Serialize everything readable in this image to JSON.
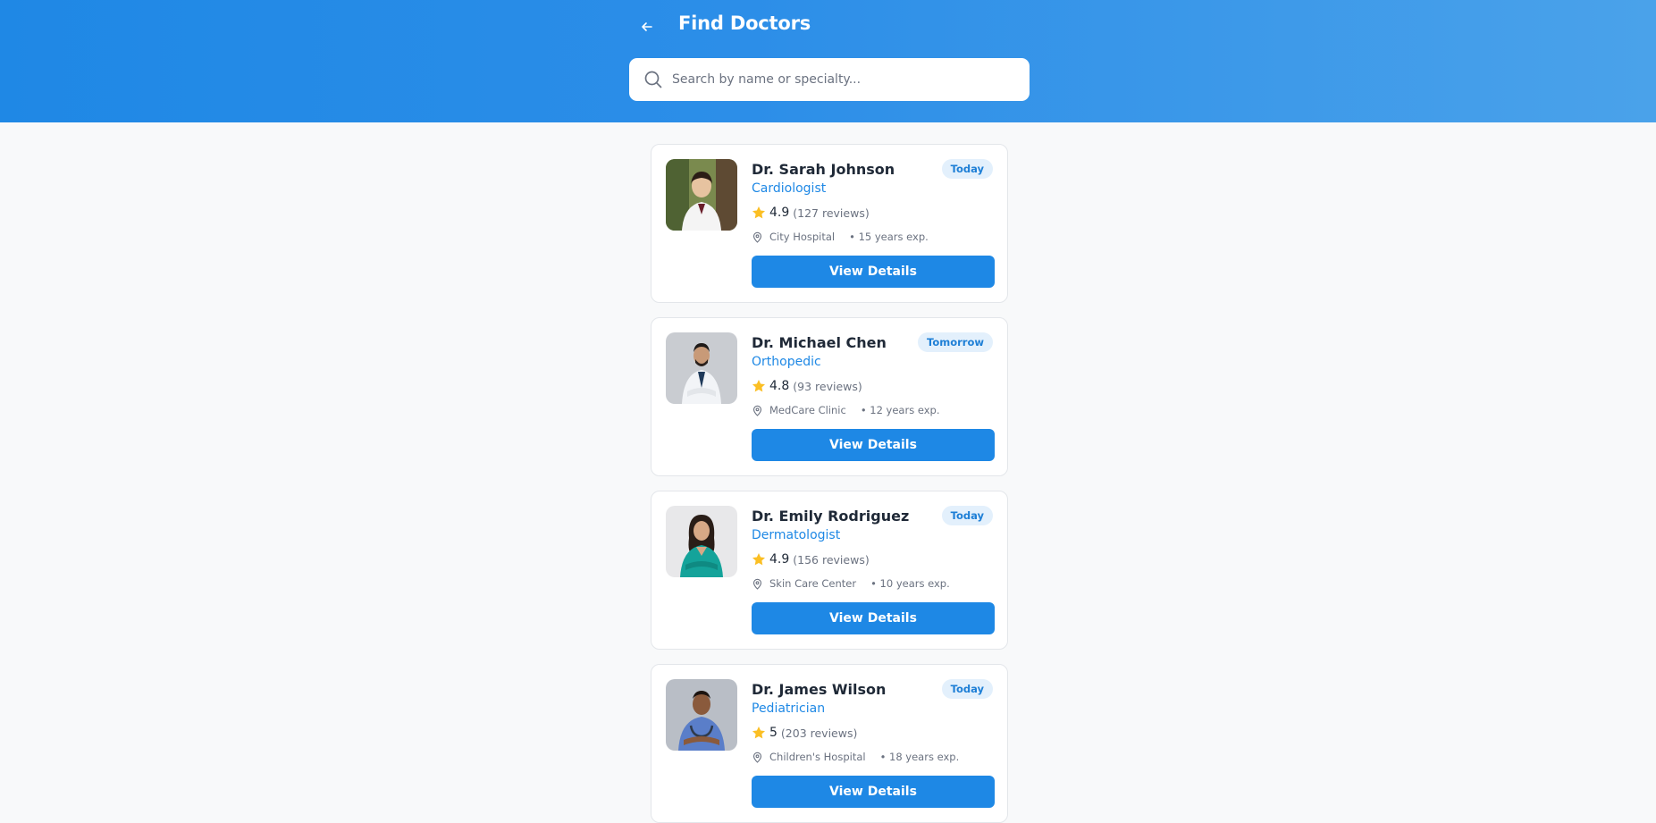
{
  "header": {
    "title": "Find Doctors",
    "back_icon": "arrow-left-icon"
  },
  "search": {
    "placeholder": "Search by name or specialty...",
    "value": "",
    "icon": "search-icon"
  },
  "doctors": [
    {
      "name": "Dr. Sarah Johnson",
      "specialty": "Cardiologist",
      "availability": "Today",
      "rating": "4.9",
      "reviews": "(127 reviews)",
      "location": "City Hospital",
      "experience": "• 15 years exp.",
      "button": "View Details"
    },
    {
      "name": "Dr. Michael Chen",
      "specialty": "Orthopedic",
      "availability": "Tomorrow",
      "rating": "4.8",
      "reviews": "(93 reviews)",
      "location": "MedCare Clinic",
      "experience": "• 12 years exp.",
      "button": "View Details"
    },
    {
      "name": "Dr. Emily Rodriguez",
      "specialty": "Dermatologist",
      "availability": "Today",
      "rating": "4.9",
      "reviews": "(156 reviews)",
      "location": "Skin Care Center",
      "experience": "• 10 years exp.",
      "button": "View Details"
    },
    {
      "name": "Dr. James Wilson",
      "specialty": "Pediatrician",
      "availability": "Today",
      "rating": "5",
      "reviews": "(203 reviews)",
      "location": "Children's Hospital",
      "experience": "• 18 years exp.",
      "button": "View Details"
    }
  ],
  "colors": {
    "header_start": "#1f88e5",
    "header_end": "#4aa2ea",
    "accent": "#1e88e5",
    "badge_bg": "#e3f0fc",
    "star": "#fbbf24",
    "page_bg": "#f8f9fa"
  }
}
